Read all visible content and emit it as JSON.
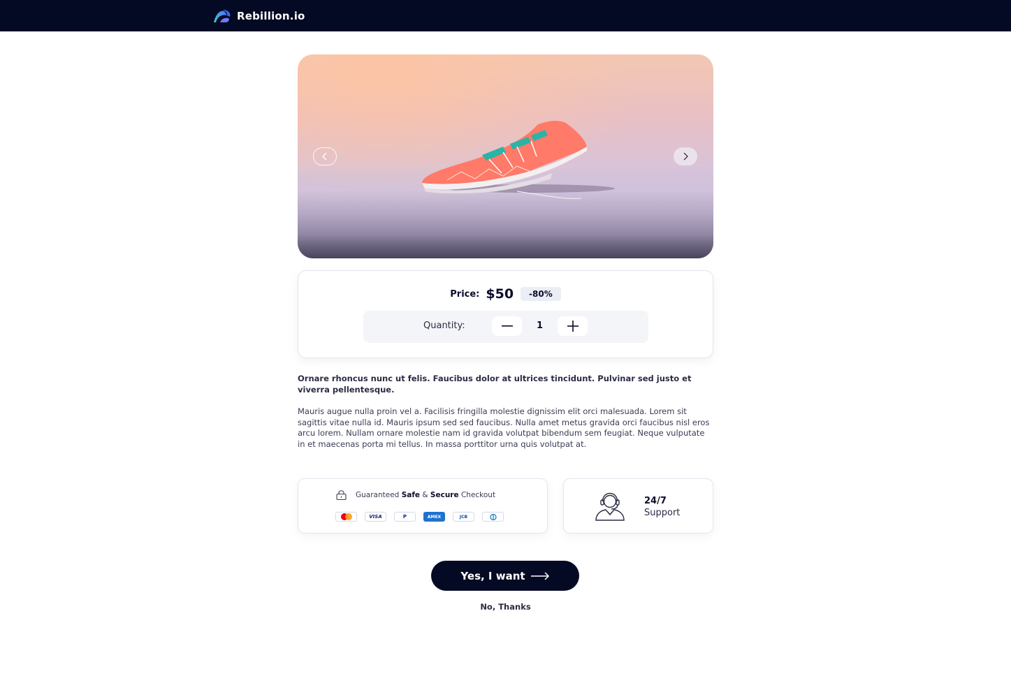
{
  "header": {
    "brand": "Rebillion.io",
    "logo_icon": "rebillion-logo-icon"
  },
  "hero": {
    "prev_icon": "chevron-left-icon",
    "next_icon": "chevron-right-icon",
    "image_subject": "sneaker-product-image"
  },
  "pricing": {
    "label": "Price:",
    "value": "$50",
    "discount": "-80%"
  },
  "quantity": {
    "label": "Quantity:",
    "value": "1",
    "minus_label": "−",
    "plus_label": "+"
  },
  "description": {
    "lead": "Ornare rhoncus nunc ut felis. Faucibus dolor at ultrices tincidunt. Pulvinar sed justo et viverra pellentesque.",
    "body": "Mauris augue nulla proin vel a. Facilisis fringilla molestie dignissim elit orci malesuada. Lorem sit sagittis vitae nulla id. Mauris ipsum sed sed faucibus. Nulla amet metus gravida orci faucibus nisl eros arcu lorem. Nullam ornare molestie nam id gravida volutpat bibendum sem feugiat. Neque vulputate in et maecenas porta mi tellus. In massa porttitor urna quis volutpat at."
  },
  "checkout": {
    "prefix": "Guaranteed",
    "safe": "Safe",
    "amp": "&",
    "secure": "Secure",
    "suffix": "Checkout",
    "lock_icon": "lock-icon",
    "payment_methods": [
      "mastercard",
      "VISA",
      "P",
      "AMEX",
      "JCB",
      "diners"
    ]
  },
  "support": {
    "title": "24/7",
    "subtitle": "Support",
    "icon": "headset-agent-icon"
  },
  "actions": {
    "accept": "Yes, I want",
    "decline": "No, Thanks"
  },
  "colors": {
    "navy": "#050a24",
    "text": "#0b0d2a",
    "accent_blue": "#3b6cf5",
    "accent_teal": "#2fd3c6"
  }
}
